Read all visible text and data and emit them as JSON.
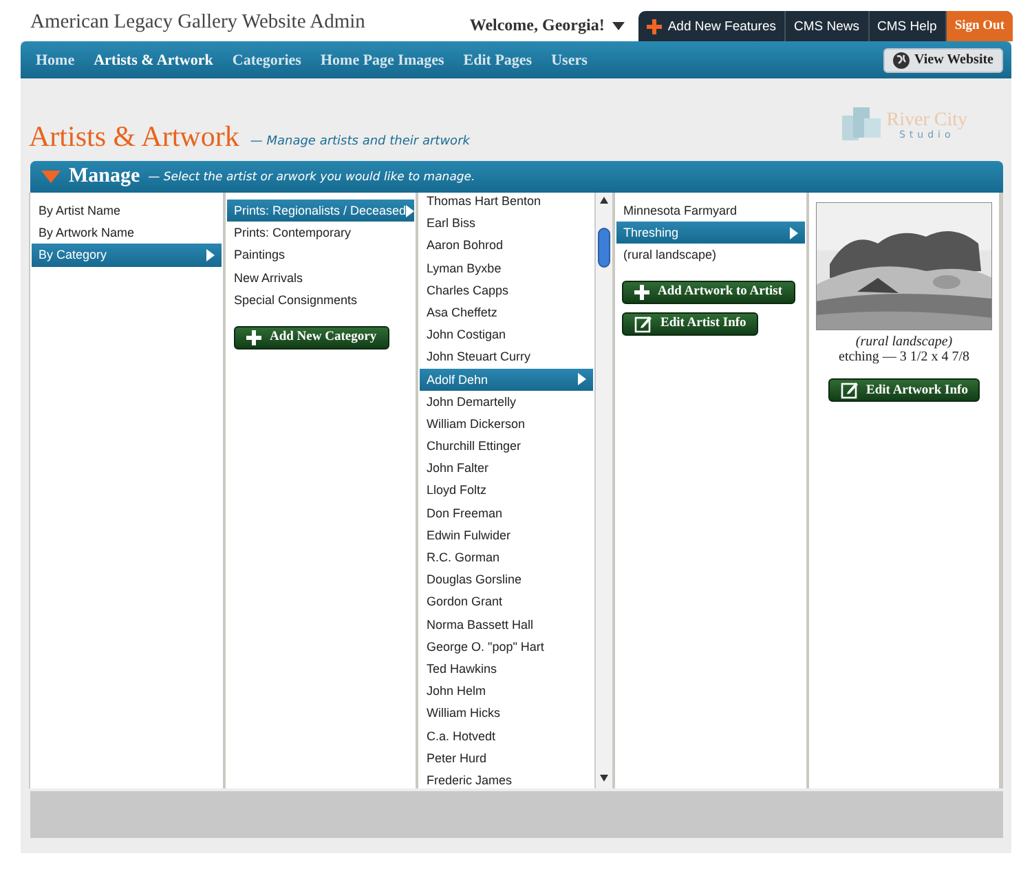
{
  "header": {
    "title": "American Legacy Gallery Website Admin",
    "welcome": "Welcome, Georgia!",
    "top_links": [
      {
        "label": "Add New Features",
        "kind": "add"
      },
      {
        "label": "CMS News",
        "kind": "plain"
      },
      {
        "label": "CMS Help",
        "kind": "plain"
      },
      {
        "label": "Sign Out",
        "kind": "signout"
      }
    ]
  },
  "nav": {
    "tabs": [
      {
        "label": "Home",
        "selected": false
      },
      {
        "label": "Artists & Artwork",
        "selected": true
      },
      {
        "label": "Categories",
        "selected": false
      },
      {
        "label": "Home Page Images",
        "selected": false
      },
      {
        "label": "Edit Pages",
        "selected": false
      },
      {
        "label": "Users",
        "selected": false
      }
    ],
    "view_button": "View Website"
  },
  "page": {
    "title": "Artists & Artwork",
    "subtitle": "— Manage artists  and their artwork",
    "logo": {
      "name": "River City",
      "sub": "Studio"
    }
  },
  "manage": {
    "title": "Manage",
    "hint": "— Select the artist or arwork you would like to manage.",
    "modes": [
      {
        "label": "By Artist Name",
        "selected": false
      },
      {
        "label": "By Artwork Name",
        "selected": false
      },
      {
        "label": "By Category",
        "selected": true
      }
    ],
    "categories": [
      {
        "label": "Prints: Regionalists / Deceased",
        "selected": true
      },
      {
        "label": "Prints: Contemporary",
        "selected": false
      },
      {
        "label": "Paintings",
        "selected": false
      },
      {
        "label": "New Arrivals",
        "selected": false
      },
      {
        "label": "Special Consignments",
        "selected": false
      }
    ],
    "add_category_button": "Add New Category",
    "artists": [
      {
        "label": "Thomas Hart Benton",
        "selected": false
      },
      {
        "label": "Earl Biss",
        "selected": false
      },
      {
        "label": "Aaron Bohrod",
        "selected": false
      },
      {
        "label": "Lyman Byxbe",
        "selected": false
      },
      {
        "label": "Charles Capps",
        "selected": false
      },
      {
        "label": "Asa Cheffetz",
        "selected": false
      },
      {
        "label": "John Costigan",
        "selected": false
      },
      {
        "label": "John Steuart Curry",
        "selected": false
      },
      {
        "label": "Adolf Dehn",
        "selected": true
      },
      {
        "label": "John Demartelly",
        "selected": false
      },
      {
        "label": "William Dickerson",
        "selected": false
      },
      {
        "label": "Churchill Ettinger",
        "selected": false
      },
      {
        "label": "John Falter",
        "selected": false
      },
      {
        "label": "Lloyd Foltz",
        "selected": false
      },
      {
        "label": "Don Freeman",
        "selected": false
      },
      {
        "label": "Edwin Fulwider",
        "selected": false
      },
      {
        "label": "R.C. Gorman",
        "selected": false
      },
      {
        "label": "Douglas Gorsline",
        "selected": false
      },
      {
        "label": "Gordon Grant",
        "selected": false
      },
      {
        "label": "Norma Bassett Hall",
        "selected": false
      },
      {
        "label": "George O. \"pop\" Hart",
        "selected": false
      },
      {
        "label": "Ted Hawkins",
        "selected": false
      },
      {
        "label": "John Helm",
        "selected": false
      },
      {
        "label": "William Hicks",
        "selected": false
      },
      {
        "label": "C.a. Hotvedt",
        "selected": false
      },
      {
        "label": "Peter Hurd",
        "selected": false
      },
      {
        "label": "Frederic James",
        "selected": false
      }
    ],
    "artworks": [
      {
        "label": "Minnesota Farmyard",
        "selected": false
      },
      {
        "label": "Threshing",
        "selected": true
      },
      {
        "label": "(rural landscape)",
        "selected": false
      }
    ],
    "artwork_buttons": [
      {
        "label": "Add Artwork to Artist",
        "kind": "add"
      },
      {
        "label": "Edit Artist Info",
        "kind": "edit"
      }
    ],
    "preview": {
      "kind": "picture",
      "caption": "(rural landscape)",
      "details": "etching — 3 1/2 x 4 7/8",
      "button": "Edit Artwork Info"
    }
  }
}
